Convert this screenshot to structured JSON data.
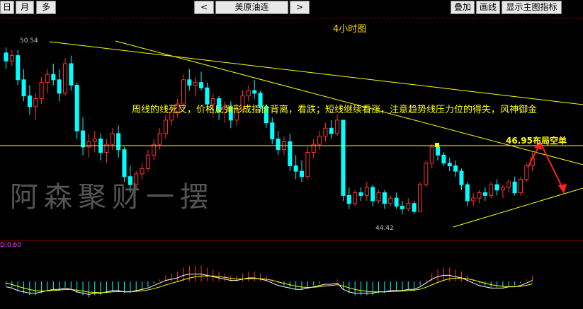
{
  "toolbar": {
    "day": "日",
    "month": "月",
    "more": "多",
    "prev": "<",
    "symbol": "美原油连",
    "next": ">",
    "overlay": "叠加",
    "draw": "画线",
    "show_indicators": "显示主图指标"
  },
  "chart": {
    "period_title": "4小时图",
    "high_label": "50.54",
    "low_label": "44.42",
    "macd_label": "D:0.60",
    "commentary": "周线的线死叉，价格反弹形成指价背离，看跌；短线继续看涨，注意趋势线压力位的得失，风神御金",
    "callout": "46.95布局空单",
    "watermark": "阿森聚财一摆"
  },
  "colors": {
    "bull": "#ff3232",
    "bear": "#00ffff",
    "trendline": "#ffff00",
    "macd_diff": "#ffffff",
    "macd_dea": "#ffff00",
    "arrow": "#ff2020"
  },
  "chart_data": {
    "type": "candlestick",
    "ohlc_y": [
      [
        50.4,
        50.6,
        49.8,
        50.1
      ],
      [
        50.1,
        50.5,
        49.9,
        50.3
      ],
      [
        50.3,
        50.5,
        49.2,
        49.4
      ],
      [
        49.4,
        49.8,
        48.6,
        48.8
      ],
      [
        48.8,
        49.2,
        48.1,
        48.4
      ],
      [
        48.4,
        48.9,
        47.9,
        48.7
      ],
      [
        48.7,
        49.5,
        48.5,
        49.3
      ],
      [
        49.3,
        49.8,
        48.9,
        49.6
      ],
      [
        49.6,
        50.0,
        49.2,
        49.4
      ],
      [
        49.4,
        49.8,
        48.6,
        48.9
      ],
      [
        48.9,
        50.2,
        48.8,
        50.0
      ],
      [
        50.0,
        50.3,
        49.0,
        49.2
      ],
      [
        49.2,
        49.3,
        47.2,
        47.5
      ],
      [
        47.5,
        48.0,
        46.6,
        46.9
      ],
      [
        46.9,
        47.4,
        46.5,
        47.1
      ],
      [
        47.1,
        47.5,
        46.7,
        47.2
      ],
      [
        47.2,
        47.4,
        46.4,
        46.7
      ],
      [
        46.7,
        47.2,
        46.3,
        47.0
      ],
      [
        47.0,
        47.6,
        46.8,
        47.4
      ],
      [
        47.4,
        47.7,
        46.5,
        46.8
      ],
      [
        46.8,
        46.9,
        45.6,
        45.8
      ],
      [
        45.8,
        46.2,
        45.2,
        45.5
      ],
      [
        45.5,
        46.0,
        45.3,
        45.9
      ],
      [
        45.9,
        46.3,
        45.7,
        46.1
      ],
      [
        46.1,
        46.8,
        46.0,
        46.6
      ],
      [
        46.6,
        47.2,
        46.4,
        47.0
      ],
      [
        47.0,
        47.6,
        46.8,
        47.4
      ],
      [
        47.4,
        48.1,
        47.2,
        47.9
      ],
      [
        47.9,
        48.4,
        47.7,
        48.2
      ],
      [
        48.2,
        48.7,
        48.0,
        48.5
      ],
      [
        48.5,
        49.6,
        48.3,
        49.4
      ],
      [
        49.4,
        49.8,
        49.0,
        49.2
      ],
      [
        49.2,
        49.5,
        48.8,
        49.3
      ],
      [
        49.3,
        49.7,
        49.0,
        49.1
      ],
      [
        49.1,
        49.3,
        48.3,
        48.5
      ],
      [
        48.5,
        48.9,
        48.0,
        48.7
      ],
      [
        48.7,
        48.8,
        47.9,
        48.2
      ],
      [
        48.2,
        48.6,
        47.8,
        48.4
      ],
      [
        48.4,
        48.6,
        47.6,
        47.9
      ],
      [
        47.9,
        48.5,
        47.7,
        48.3
      ],
      [
        48.3,
        49.0,
        48.2,
        48.8
      ],
      [
        48.8,
        49.2,
        48.6,
        49.0
      ],
      [
        49.0,
        49.4,
        48.7,
        48.9
      ],
      [
        48.9,
        49.0,
        48.2,
        48.4
      ],
      [
        48.4,
        48.5,
        47.6,
        47.8
      ],
      [
        47.8,
        48.0,
        47.0,
        47.2
      ],
      [
        47.2,
        47.5,
        46.6,
        46.8
      ],
      [
        46.8,
        47.3,
        46.6,
        47.1
      ],
      [
        47.1,
        47.4,
        46.0,
        46.2
      ],
      [
        46.2,
        46.6,
        45.7,
        46.0
      ],
      [
        46.0,
        46.4,
        45.6,
        45.8
      ],
      [
        45.8,
        46.9,
        45.7,
        46.7
      ],
      [
        46.7,
        47.2,
        46.5,
        47.0
      ],
      [
        47.0,
        47.5,
        46.8,
        47.3
      ],
      [
        47.3,
        47.8,
        47.1,
        47.6
      ],
      [
        47.6,
        47.9,
        47.2,
        47.4
      ],
      [
        47.4,
        48.1,
        47.3,
        47.9
      ],
      [
        47.9,
        47.9,
        44.9,
        45.1
      ],
      [
        45.1,
        45.4,
        44.6,
        44.8
      ],
      [
        44.8,
        45.3,
        44.7,
        45.2
      ],
      [
        45.2,
        45.4,
        44.9,
        45.1
      ],
      [
        45.1,
        45.6,
        44.9,
        45.4
      ],
      [
        45.4,
        45.5,
        44.7,
        44.9
      ],
      [
        44.9,
        45.3,
        44.8,
        45.2
      ],
      [
        45.2,
        45.3,
        44.6,
        44.8
      ],
      [
        44.8,
        45.1,
        44.7,
        45.0
      ],
      [
        45.0,
        45.2,
        44.6,
        44.7
      ],
      [
        44.7,
        44.9,
        44.4,
        44.6
      ],
      [
        44.6,
        45.0,
        44.5,
        44.8
      ],
      [
        44.8,
        44.9,
        44.4,
        44.5
      ],
      [
        44.5,
        45.6,
        44.5,
        45.5
      ],
      [
        45.5,
        46.4,
        45.4,
        46.3
      ],
      [
        46.3,
        47.0,
        46.1,
        46.9
      ],
      [
        46.9,
        47.0,
        46.4,
        46.6
      ],
      [
        46.6,
        46.7,
        46.2,
        46.3
      ],
      [
        46.3,
        46.5,
        46.0,
        46.2
      ],
      [
        46.2,
        46.4,
        45.8,
        46.0
      ],
      [
        46.0,
        46.1,
        45.3,
        45.5
      ],
      [
        45.5,
        45.6,
        44.7,
        44.9
      ],
      [
        44.9,
        45.2,
        44.7,
        45.0
      ],
      [
        45.0,
        45.3,
        44.8,
        45.2
      ],
      [
        45.2,
        45.4,
        44.9,
        45.1
      ],
      [
        45.1,
        45.6,
        45.0,
        45.5
      ],
      [
        45.5,
        45.7,
        45.1,
        45.3
      ],
      [
        45.3,
        45.5,
        45.0,
        45.4
      ],
      [
        45.4,
        45.7,
        45.2,
        45.6
      ],
      [
        45.6,
        45.8,
        45.1,
        45.2
      ],
      [
        45.2,
        45.8,
        45.1,
        45.7
      ],
      [
        45.7,
        46.3,
        45.6,
        46.2
      ],
      [
        46.2,
        46.7,
        46.0,
        46.5
      ]
    ],
    "ylim": [
      43.9,
      51.0
    ],
    "resistance_level": 46.95,
    "macd": [
      -0.2,
      -0.3,
      -0.5,
      -0.6,
      -0.7,
      -0.7,
      -0.6,
      -0.5,
      -0.4,
      -0.4,
      -0.3,
      -0.4,
      -0.6,
      -0.7,
      -0.8,
      -0.7,
      -0.7,
      -0.6,
      -0.5,
      -0.5,
      -0.6,
      -0.6,
      -0.5,
      -0.4,
      -0.3,
      -0.1,
      0.1,
      0.3,
      0.4,
      0.5,
      0.7,
      0.8,
      0.8,
      0.8,
      0.7,
      0.6,
      0.5,
      0.4,
      0.3,
      0.3,
      0.4,
      0.5,
      0.5,
      0.4,
      0.3,
      0.1,
      -0.1,
      -0.2,
      -0.3,
      -0.4,
      -0.4,
      -0.3,
      -0.2,
      -0.1,
      0.0,
      0.0,
      0.1,
      -0.4,
      -0.6,
      -0.7,
      -0.7,
      -0.7,
      -0.7,
      -0.6,
      -0.6,
      -0.5,
      -0.5,
      -0.5,
      -0.4,
      -0.4,
      -0.2,
      0.1,
      0.4,
      0.6,
      0.7,
      0.7,
      0.6,
      0.5,
      0.3,
      0.1,
      -0.1,
      -0.2,
      -0.3,
      -0.3,
      -0.3,
      -0.2,
      -0.2,
      -0.1,
      0.1,
      0.3
    ]
  }
}
